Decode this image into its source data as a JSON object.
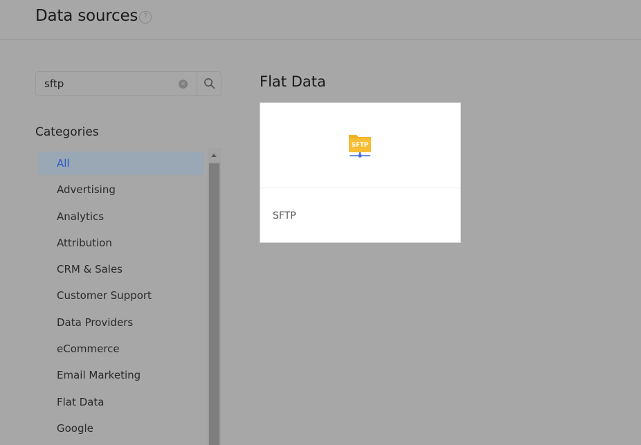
{
  "header": {
    "title": "Data sources",
    "help_glyph": "?"
  },
  "search": {
    "value": "sftp",
    "placeholder": ""
  },
  "categories": {
    "title": "Categories",
    "items": [
      {
        "label": "All",
        "active": true
      },
      {
        "label": "Advertising"
      },
      {
        "label": "Analytics"
      },
      {
        "label": "Attribution"
      },
      {
        "label": "CRM & Sales"
      },
      {
        "label": "Customer Support"
      },
      {
        "label": "Data Providers"
      },
      {
        "label": "eCommerce"
      },
      {
        "label": "Email Marketing"
      },
      {
        "label": "Flat Data"
      },
      {
        "label": "Google"
      }
    ]
  },
  "section": {
    "title": "Flat Data",
    "cards": [
      {
        "label": "SFTP",
        "icon_text": "SFTP"
      }
    ]
  },
  "colors": {
    "background": "#a7a7a7",
    "active_item_bg": "#9aa7b4",
    "active_item_text": "#2c59c7",
    "sftp_folder": "#f5b324"
  }
}
